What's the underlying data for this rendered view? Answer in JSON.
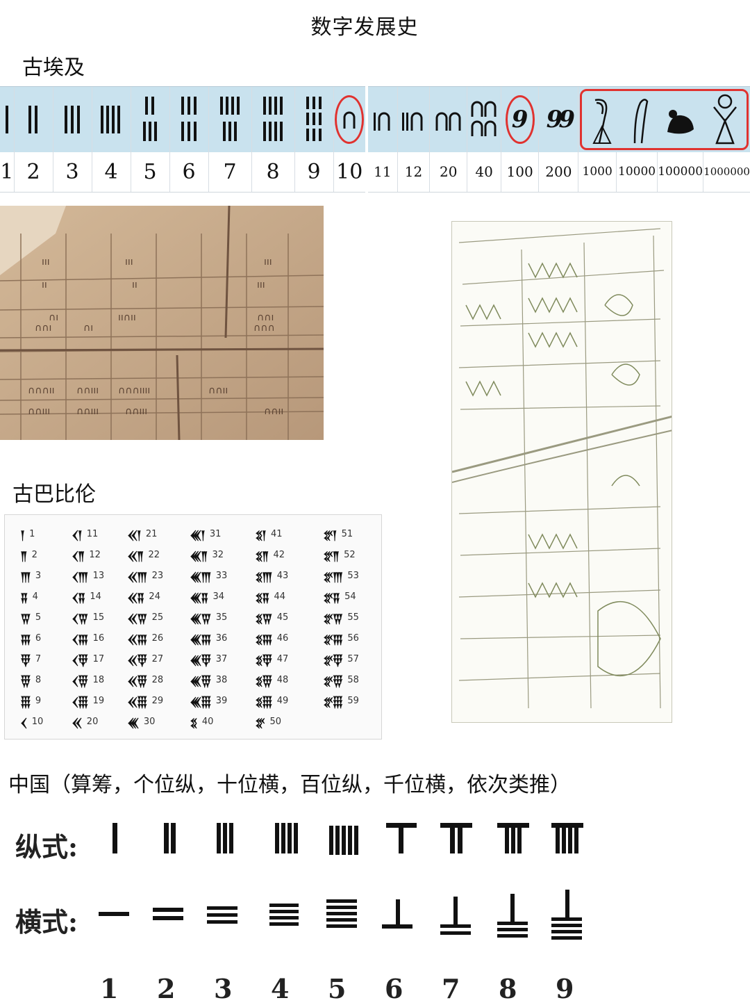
{
  "title": "数字发展史",
  "egypt": {
    "heading": "古埃及",
    "left_numbers": [
      "1",
      "2",
      "3",
      "4",
      "5",
      "6",
      "7",
      "8",
      "9",
      "10"
    ],
    "right_numbers": [
      "11",
      "12",
      "20",
      "40",
      "100",
      "200",
      "1000",
      "10000",
      "100000",
      "1000000"
    ]
  },
  "babylon": {
    "heading": "古巴比伦",
    "columns": [
      [
        "1",
        "2",
        "3",
        "4",
        "5",
        "6",
        "7",
        "8",
        "9",
        "10"
      ],
      [
        "11",
        "12",
        "13",
        "14",
        "15",
        "16",
        "17",
        "18",
        "19",
        "20"
      ],
      [
        "21",
        "22",
        "23",
        "24",
        "25",
        "26",
        "27",
        "28",
        "29",
        "30"
      ],
      [
        "31",
        "32",
        "33",
        "34",
        "35",
        "36",
        "37",
        "38",
        "39",
        "40"
      ],
      [
        "41",
        "42",
        "43",
        "44",
        "45",
        "46",
        "47",
        "48",
        "49",
        "50"
      ],
      [
        "51",
        "52",
        "53",
        "54",
        "55",
        "56",
        "57",
        "58",
        "59"
      ]
    ]
  },
  "china": {
    "heading": "中国（算筹，个位纵，十位横，百位纵，千位横，依次类推）",
    "vertical_label": "纵式:",
    "horizontal_label": "横式:",
    "digits": [
      "1",
      "2",
      "3",
      "4",
      "5",
      "6",
      "7",
      "8",
      "9"
    ]
  }
}
